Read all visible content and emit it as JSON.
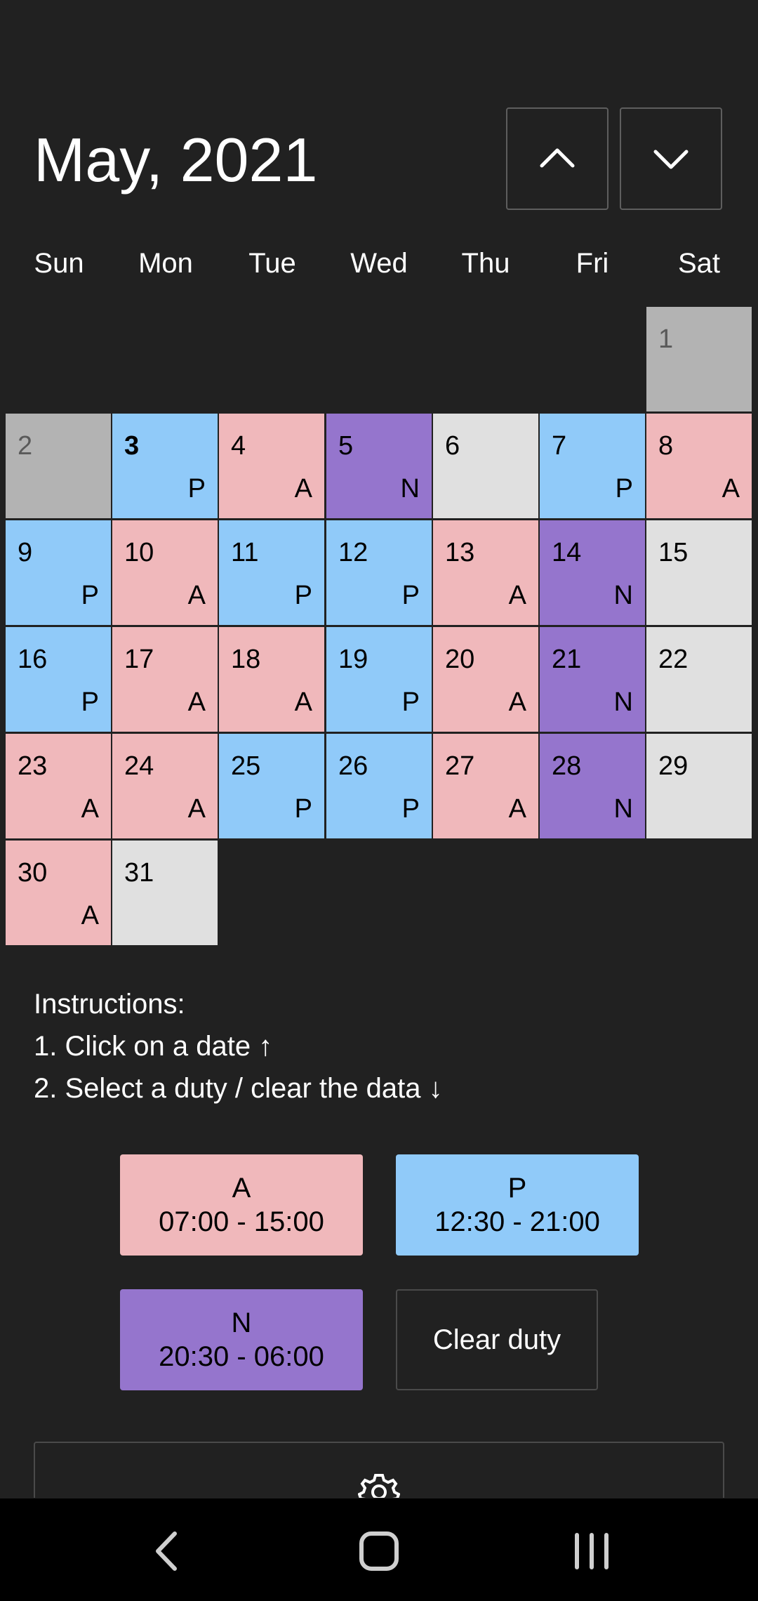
{
  "header": {
    "month_title": "May, 2021",
    "prev_icon": "chevron-up-icon",
    "next_icon": "chevron-down-icon"
  },
  "weekdays": [
    "Sun",
    "Mon",
    "Tue",
    "Wed",
    "Thu",
    "Fri",
    "Sat"
  ],
  "colors": {
    "A": "#f0b8bb",
    "P": "#90caf9",
    "N": "#9575cd",
    "none": "#e0e0e0",
    "past": "#b3b3b3",
    "background": "#212121"
  },
  "calendar": {
    "first_weekday_index": 6,
    "today": 3,
    "days": [
      {
        "day": "1",
        "duty": "",
        "state": "past"
      },
      {
        "day": "2",
        "duty": "",
        "state": "past"
      },
      {
        "day": "3",
        "duty": "P",
        "state": "today"
      },
      {
        "day": "4",
        "duty": "A",
        "state": ""
      },
      {
        "day": "5",
        "duty": "N",
        "state": ""
      },
      {
        "day": "6",
        "duty": "",
        "state": ""
      },
      {
        "day": "7",
        "duty": "P",
        "state": ""
      },
      {
        "day": "8",
        "duty": "A",
        "state": ""
      },
      {
        "day": "9",
        "duty": "P",
        "state": ""
      },
      {
        "day": "10",
        "duty": "A",
        "state": ""
      },
      {
        "day": "11",
        "duty": "P",
        "state": ""
      },
      {
        "day": "12",
        "duty": "P",
        "state": ""
      },
      {
        "day": "13",
        "duty": "A",
        "state": ""
      },
      {
        "day": "14",
        "duty": "N",
        "state": ""
      },
      {
        "day": "15",
        "duty": "",
        "state": ""
      },
      {
        "day": "16",
        "duty": "P",
        "state": ""
      },
      {
        "day": "17",
        "duty": "A",
        "state": ""
      },
      {
        "day": "18",
        "duty": "A",
        "state": ""
      },
      {
        "day": "19",
        "duty": "P",
        "state": ""
      },
      {
        "day": "20",
        "duty": "A",
        "state": ""
      },
      {
        "day": "21",
        "duty": "N",
        "state": ""
      },
      {
        "day": "22",
        "duty": "",
        "state": ""
      },
      {
        "day": "23",
        "duty": "A",
        "state": ""
      },
      {
        "day": "24",
        "duty": "A",
        "state": ""
      },
      {
        "day": "25",
        "duty": "P",
        "state": ""
      },
      {
        "day": "26",
        "duty": "P",
        "state": ""
      },
      {
        "day": "27",
        "duty": "A",
        "state": ""
      },
      {
        "day": "28",
        "duty": "N",
        "state": ""
      },
      {
        "day": "29",
        "duty": "",
        "state": ""
      },
      {
        "day": "30",
        "duty": "A",
        "state": ""
      },
      {
        "day": "31",
        "duty": "",
        "state": ""
      }
    ]
  },
  "instructions": {
    "title": "Instructions:",
    "step1": "1. Click on a date ↑",
    "step2": "2. Select a duty / clear the data ↓"
  },
  "duties": [
    {
      "code": "A",
      "time": "07:00 - 15:00"
    },
    {
      "code": "P",
      "time": "12:30 - 21:00"
    },
    {
      "code": "N",
      "time": "20:30 - 06:00"
    }
  ],
  "clear_label": "Clear duty",
  "settings_icon": "gear-icon",
  "system_nav": {
    "back_icon": "back-icon",
    "home_icon": "home-icon",
    "recents_icon": "recents-icon"
  }
}
